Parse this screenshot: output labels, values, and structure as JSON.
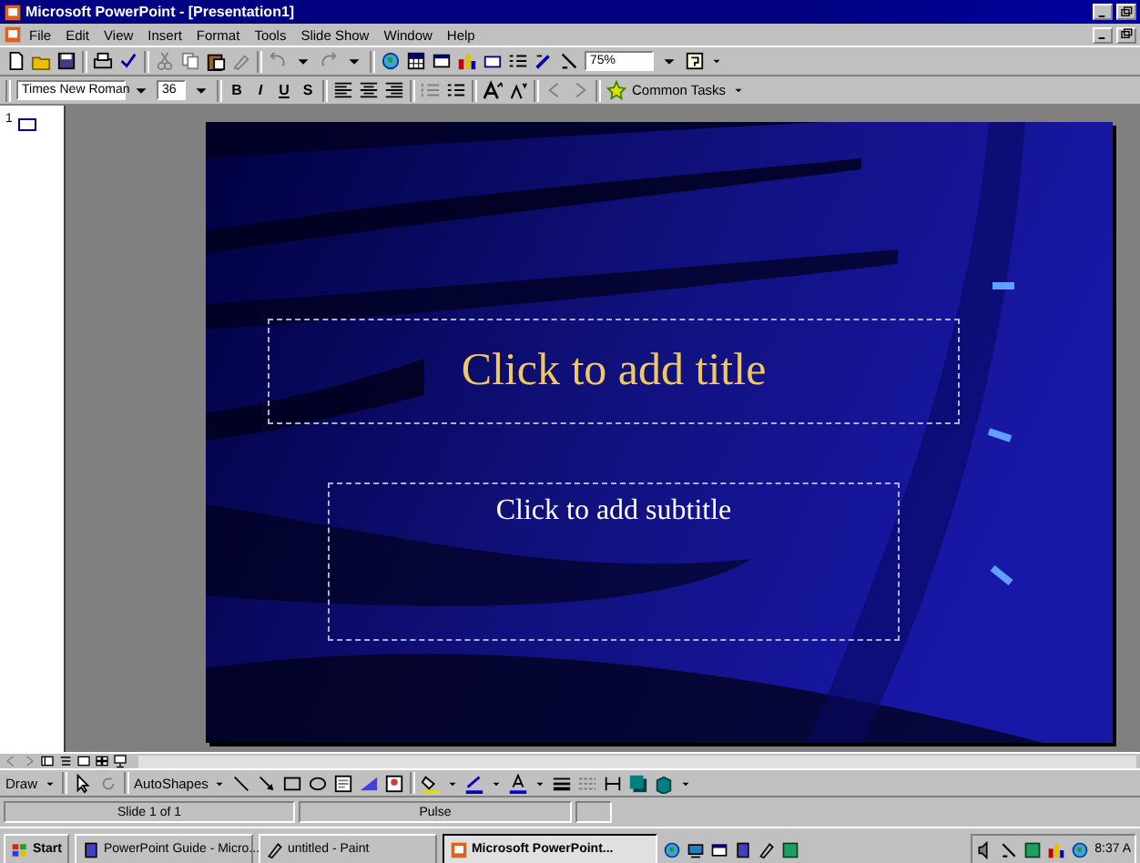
{
  "window": {
    "title": "Microsoft PowerPoint - [Presentation1]"
  },
  "menu": [
    "File",
    "Edit",
    "View",
    "Insert",
    "Format",
    "Tools",
    "Slide Show",
    "Window",
    "Help"
  ],
  "standard_toolbar": {
    "zoom": "75%"
  },
  "formatting_toolbar": {
    "font": "Times New Roman",
    "size": "36",
    "style_buttons": [
      "B",
      "I",
      "U",
      "S"
    ],
    "common_tasks": "Common Tasks"
  },
  "outline": {
    "slide_number": "1"
  },
  "slide": {
    "title_placeholder": "Click to add title",
    "subtitle_placeholder": "Click to add subtitle"
  },
  "drawing_toolbar": {
    "draw": "Draw",
    "autoshapes": "AutoShapes"
  },
  "status_bar": {
    "slide": "Slide 1 of 1",
    "design": "Pulse"
  },
  "taskbar": {
    "start": "Start",
    "tasks": [
      {
        "label": "PowerPoint Guide - Micro...",
        "selected": false
      },
      {
        "label": "untitled - Paint",
        "selected": false
      },
      {
        "label": "Microsoft PowerPoint...",
        "selected": true
      }
    ],
    "clock": "8:37 A"
  }
}
